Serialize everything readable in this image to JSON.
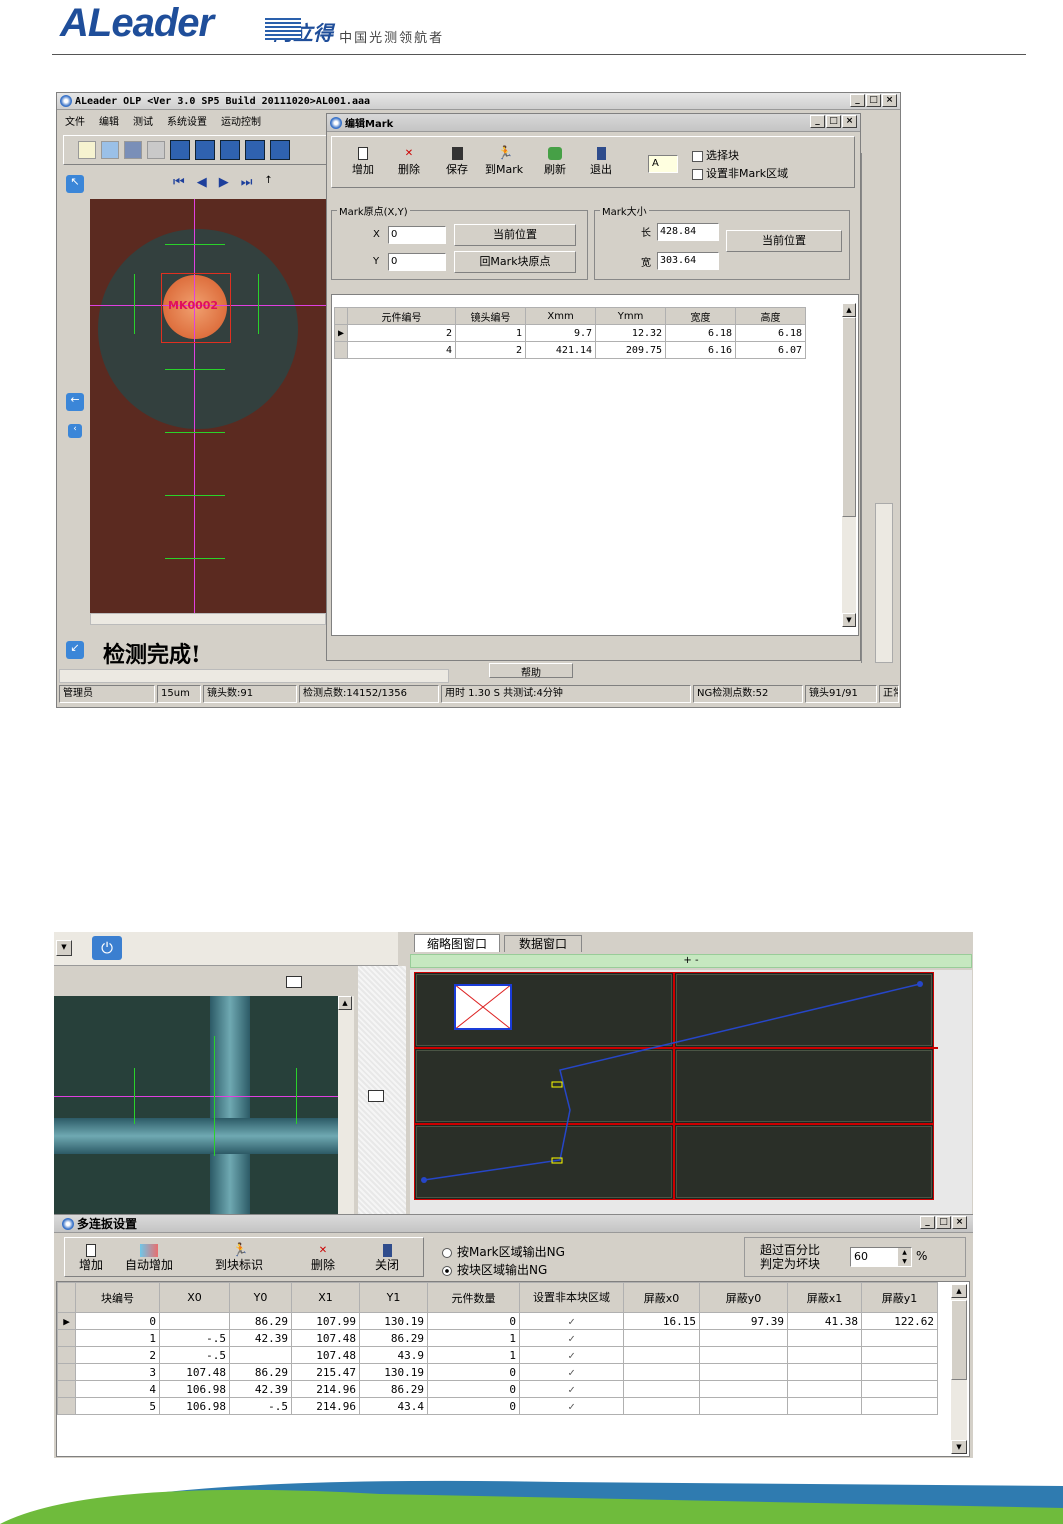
{
  "header": {
    "logo_text": "ALeader",
    "logo_cn": "阿立得",
    "slogan": "中国光测领航者"
  },
  "app": {
    "title": "ALeader OLP  <Ver 3.0 SP5  Build 20111020>AL001.aaa",
    "menu": [
      "文件",
      "编辑",
      "测试",
      "系统设置",
      "运动控制"
    ],
    "status_done": "检测完成!",
    "help_tab": "帮助",
    "statusbar": [
      "管理员",
      "15um",
      "镜头数:91",
      "检测点数:14152/1356",
      "用时  1.30 S   共测试:4分钟",
      "NG检测点数:52",
      "镜头91/91",
      "正常"
    ]
  },
  "mark_dialog": {
    "title": "编辑Mark",
    "tools": [
      "增加",
      "删除",
      "保存",
      "到Mark",
      "刷新",
      "退出"
    ],
    "name_value": "A",
    "checkbox_select_block": "选择块",
    "checkbox_non_mark": "设置非Mark区域",
    "origin_group": "Mark原点(X,Y)",
    "x_label": "X",
    "x_value": "0",
    "y_label": "Y",
    "y_value": "0",
    "btn_current_pos": "当前位置",
    "btn_return_origin": "回Mark块原点",
    "size_group": "Mark大小",
    "len_label": "长",
    "len_value": "428.84",
    "wid_label": "宽",
    "wid_value": "303.64",
    "btn_size_current": "当前位置",
    "columns": [
      "元件编号",
      "镜头编号",
      "Xmm",
      "Ymm",
      "宽度",
      "高度"
    ],
    "rows": [
      [
        "2",
        "1",
        "9.7",
        "12.32",
        "6.18",
        "6.18"
      ],
      [
        "4",
        "2",
        "421.14",
        "209.75",
        "6.16",
        "6.07"
      ]
    ]
  },
  "camera": {
    "mark_label": "MK0002"
  },
  "lower": {
    "tabs": [
      "缩略图窗口",
      "数据窗口"
    ],
    "thumb_bar": "+ -"
  },
  "panel_dialog": {
    "title": "多连扳设置",
    "tools": [
      "增加",
      "自动增加",
      "到块标识",
      "删除",
      "关闭"
    ],
    "radio1": "按Mark区域输出NG",
    "radio2": "按块区域输出NG",
    "pct_label1": "超过百分比",
    "pct_label2": "判定为坏块",
    "pct_value": "60",
    "pct_unit": "%",
    "columns": [
      "块编号",
      "X0",
      "Y0",
      "X1",
      "Y1",
      "元件数量",
      "设置非本块区域",
      "屏蔽x0",
      "屏蔽y0",
      "屏蔽x1",
      "屏蔽y1"
    ],
    "rows": [
      [
        "0",
        "",
        "86.29",
        "107.99",
        "130.19",
        "0",
        "✓",
        "16.15",
        "97.39",
        "41.38",
        "122.62"
      ],
      [
        "1",
        "-.5",
        "42.39",
        "107.48",
        "86.29",
        "1",
        "✓",
        "",
        "",
        "",
        ""
      ],
      [
        "2",
        "-.5",
        "",
        "107.48",
        "43.9",
        "1",
        "✓",
        "",
        "",
        "",
        ""
      ],
      [
        "3",
        "107.48",
        "86.29",
        "215.47",
        "130.19",
        "0",
        "✓",
        "",
        "",
        "",
        ""
      ],
      [
        "4",
        "106.98",
        "42.39",
        "214.96",
        "86.29",
        "0",
        "✓",
        "",
        "",
        "",
        ""
      ],
      [
        "5",
        "106.98",
        "-.5",
        "214.96",
        "43.4",
        "0",
        "✓",
        "",
        "",
        "",
        ""
      ]
    ]
  }
}
